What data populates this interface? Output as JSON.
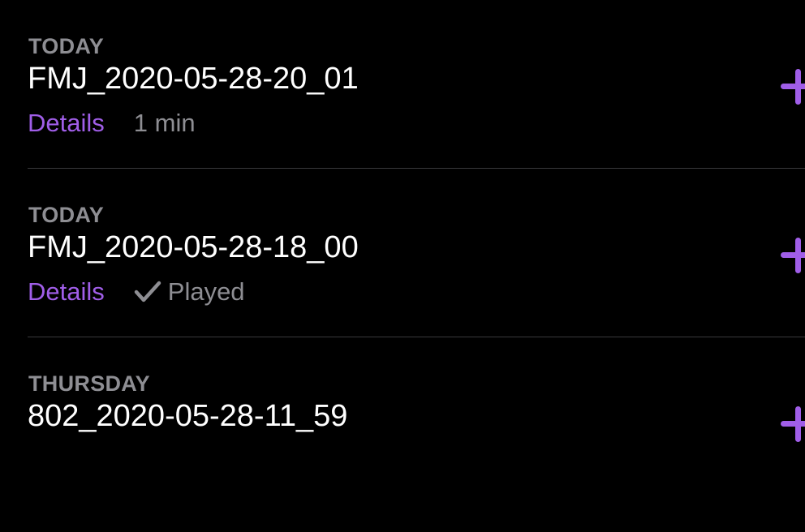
{
  "episodes": [
    {
      "date_label": "TODAY",
      "title": "FMJ_2020-05-28-20_01",
      "details_label": "Details",
      "status": "1 min",
      "played": false
    },
    {
      "date_label": "TODAY",
      "title": "FMJ_2020-05-28-18_00",
      "details_label": "Details",
      "status": "Played",
      "played": true
    },
    {
      "date_label": "THURSDAY",
      "title": "802_2020-05-28-11_59"
    }
  ],
  "colors": {
    "accent": "#a05ee8",
    "secondary": "#8e8e93",
    "background": "#000000"
  }
}
